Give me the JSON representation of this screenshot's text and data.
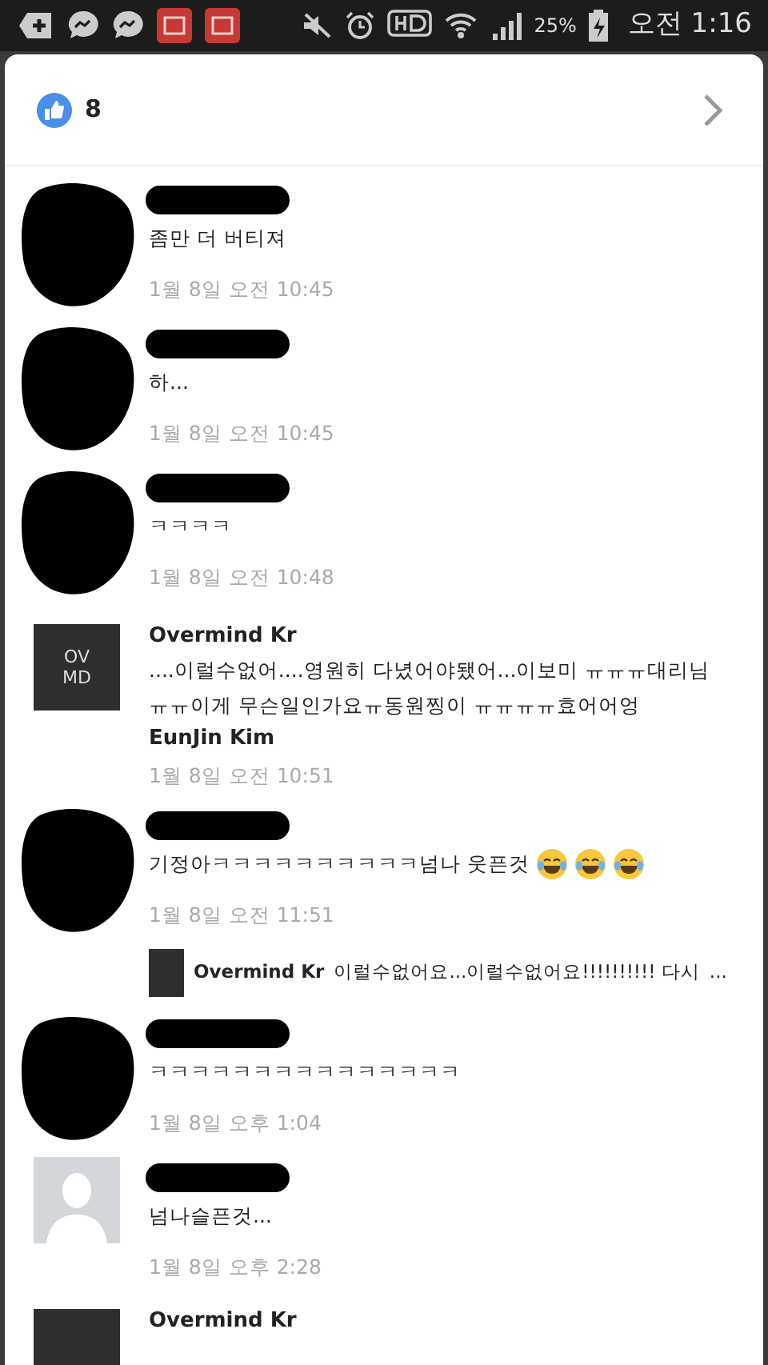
{
  "status_bar": {
    "battery_percent": "25%",
    "time": "오전 1:16"
  },
  "header": {
    "like_count": "8"
  },
  "comments": [
    {
      "avatar": {
        "kind": "redacted"
      },
      "author_redacted": true,
      "text": "좀만 더 버티져",
      "time": "1월 8일 오전 10:45"
    },
    {
      "avatar": {
        "kind": "redacted"
      },
      "author_redacted": true,
      "text": "하...",
      "time": "1월 8일 오전 10:45"
    },
    {
      "avatar": {
        "kind": "redacted"
      },
      "author_redacted": true,
      "text": "ㅋㅋㅋㅋ",
      "time": "1월 8일 오전 10:48"
    },
    {
      "avatar": {
        "kind": "logo",
        "text": [
          "OV",
          "MD"
        ]
      },
      "author_redacted": false,
      "author": "Overmind Kr",
      "text": "....이럴수없어....영원히 다녔어야됐어...이보미 ㅠㅠㅠ대리님ㅠㅠ이게 무슨일인가요ㅠ동원찡이 ㅠㅠㅠㅠ효어어엉",
      "tag": "EunJin Kim",
      "time": "1월 8일 오전 10:51"
    },
    {
      "avatar": {
        "kind": "redacted"
      },
      "author_redacted": true,
      "text": "기정아ㅋㅋㅋㅋㅋㅋㅋㅋㅋㅋ넘나 웃픈것",
      "emoji": [
        {
          "kind": "tears-of-joy"
        },
        {
          "kind": "tears-of-joy"
        },
        {
          "kind": "tears-of-joy"
        }
      ],
      "time": "1월 8일 오전 11:51",
      "reply": {
        "author": "Overmind Kr",
        "text": "이럴수없어요...이럴수없어요!!!!!!!!!! 다시",
        "more": "..."
      }
    },
    {
      "avatar": {
        "kind": "redacted"
      },
      "author_redacted": true,
      "text": "ㅋㅋㅋㅋㅋㅋㅋㅋㅋㅋㅋㅋㅋㅋㅋ",
      "time": "1월 8일 오후 1:04"
    },
    {
      "avatar": {
        "kind": "placeholder"
      },
      "author_redacted": true,
      "text": "넘나슬픈것...",
      "time": "1월 8일 오후 2:28"
    },
    {
      "avatar": {
        "kind": "logo"
      },
      "author_redacted": false,
      "author": "Overmind Kr"
    }
  ]
}
